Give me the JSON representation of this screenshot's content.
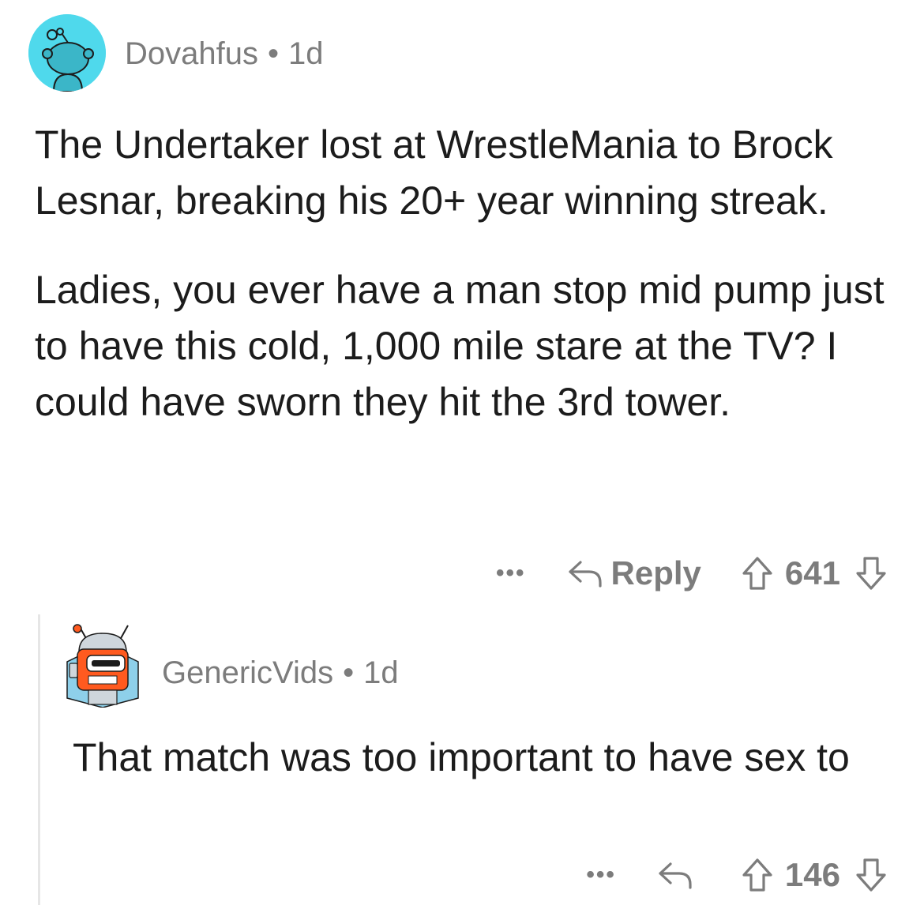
{
  "comments": [
    {
      "username": "Dovahfus",
      "separator": "•",
      "age": "1d",
      "paragraphs": [
        "The Undertaker lost at WrestleMania to Brock Lesnar, breaking his 20+ year winning streak.",
        "Ladies, you ever have a man stop mid pump just to have this cold, 1,000 mile stare at the TV? I could have sworn they hit the 3rd tower."
      ],
      "more_label": "•••",
      "reply_label": "Reply",
      "score": "641"
    },
    {
      "username": "GenericVids",
      "separator": "•",
      "age": "1d",
      "paragraphs": [
        "That match was too important to have sex to"
      ],
      "more_label": "•••",
      "score": "146"
    }
  ],
  "colors": {
    "avatar_1_bg": "#4fd9ec",
    "meta_text": "#7c7c7c",
    "body_text": "#1c1c1c",
    "thread_line": "#e6e6e6"
  },
  "icons": {
    "reply": "reply-arrow-icon",
    "upvote": "upvote-arrow-icon",
    "downvote": "downvote-arrow-icon"
  }
}
